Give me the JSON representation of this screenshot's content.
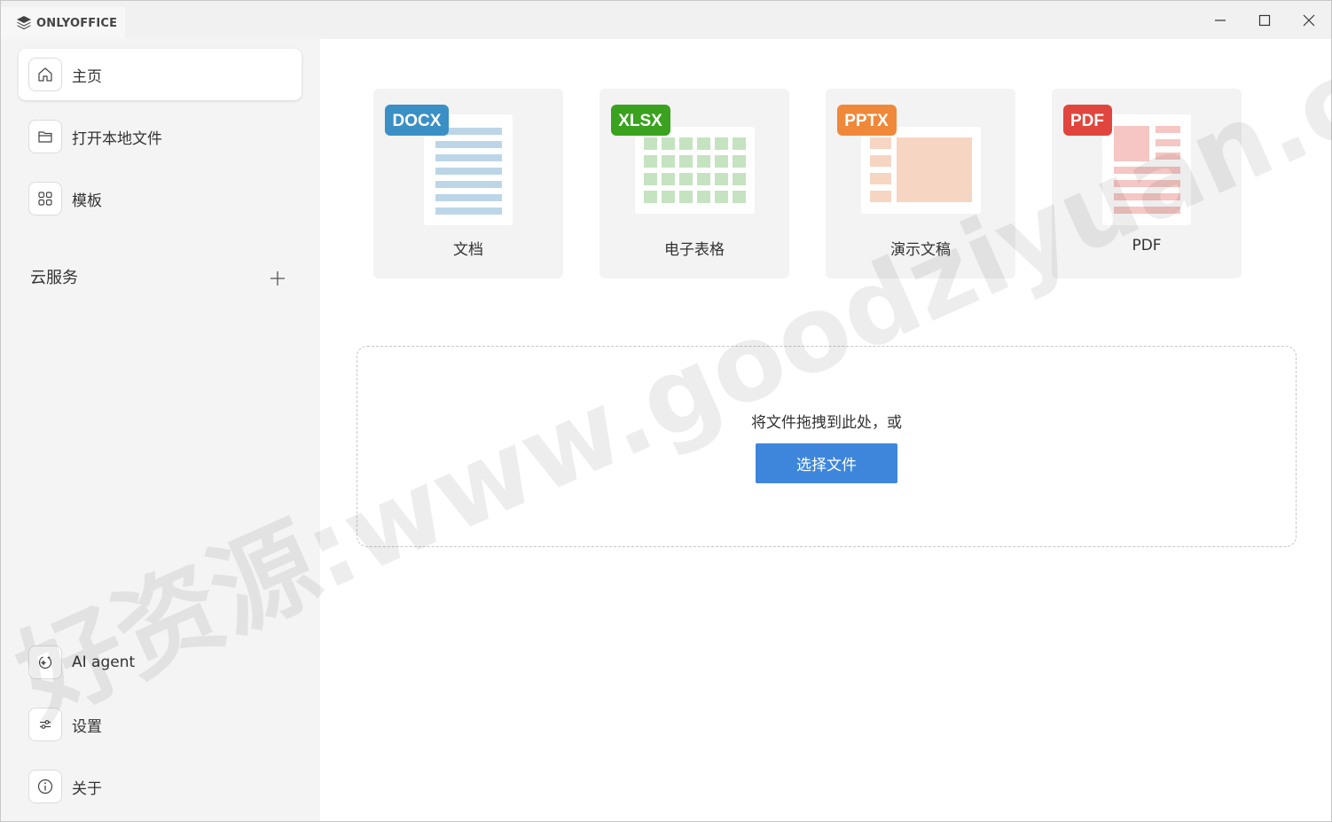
{
  "app": {
    "name": "ONLYOFFICE"
  },
  "sidebar": {
    "items": [
      {
        "label": "主页",
        "icon": "home-icon"
      },
      {
        "label": "打开本地文件",
        "icon": "folder-icon"
      },
      {
        "label": "模板",
        "icon": "grid-icon"
      }
    ],
    "cloud_label": "云服务",
    "bottom_items": [
      {
        "label": "AI agent",
        "icon": "ai-agent-icon"
      },
      {
        "label": "设置",
        "icon": "sliders-icon"
      },
      {
        "label": "关于",
        "icon": "info-icon"
      }
    ]
  },
  "cards": [
    {
      "badge": "DOCX",
      "label": "文档",
      "color": "#3a8fc5"
    },
    {
      "badge": "XLSX",
      "label": "电子表格",
      "color": "#3aa21e"
    },
    {
      "badge": "PPTX",
      "label": "演示文稿",
      "color": "#f0883a"
    },
    {
      "badge": "PDF",
      "label": "PDF",
      "color": "#e0463d"
    }
  ],
  "dropzone": {
    "text": "将文件拖拽到此处，或",
    "button": "选择文件"
  },
  "watermark": "好资源:www.goodziyuan.com",
  "colors": {
    "accent": "#3d86dc",
    "sidebar_bg": "#f4f4f4"
  }
}
